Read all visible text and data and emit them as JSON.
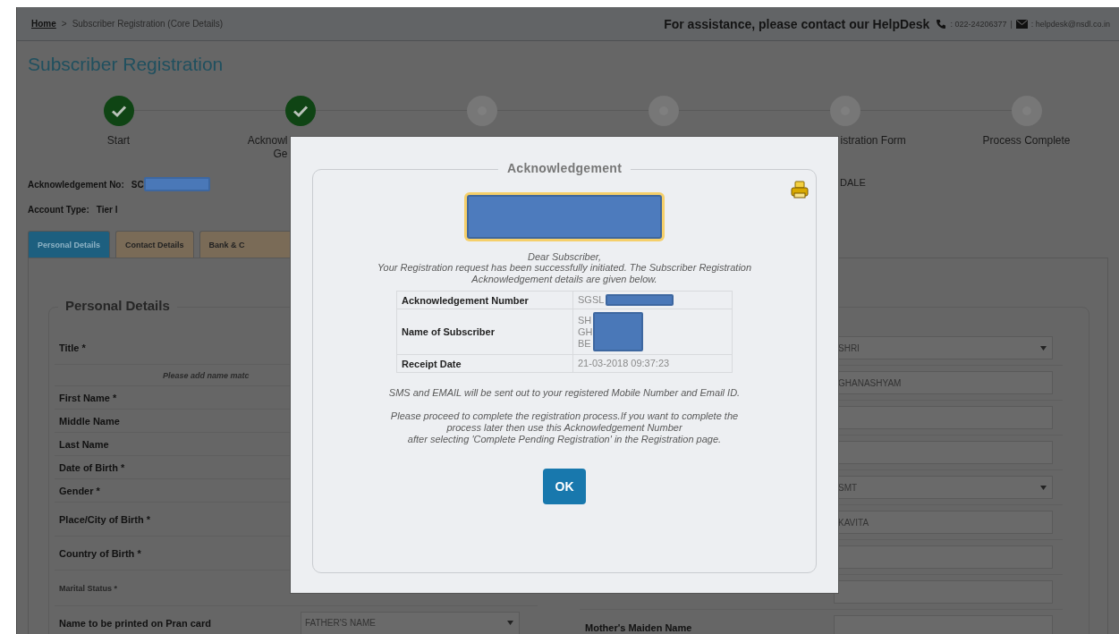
{
  "breadcrumb": [
    {
      "kind": "link",
      "label": "Home"
    },
    {
      "kind": "separator",
      "label": ">"
    },
    {
      "kind": "current",
      "label": "Subscriber Registration (Core Details)"
    }
  ],
  "helpdesk": {
    "text": "For assistance, please contact our HelpDesk",
    "phone": ": 022-24206377",
    "separator": "|",
    "email": ": helpdesk@nsdl.co.in"
  },
  "page_title": "Subscriber Registration",
  "steps": [
    {
      "label_lines": [
        "Start"
      ],
      "done": true,
      "clipped_end": false,
      "clipped_start": false
    },
    {
      "label_lines": [
        "Acknowl",
        "Ge"
      ],
      "done": true,
      "clipped_end": true,
      "clipped_start": false
    },
    {
      "done": false
    },
    {
      "done": false
    },
    {
      "label_lines": [
        "istration Form"
      ],
      "done": false,
      "clipped_end": false,
      "clipped_start": true
    },
    {
      "label_lines": [
        "Process Complete"
      ],
      "done": false,
      "clipped_end": false,
      "clipped_start": false
    }
  ],
  "acknowledgement_no": {
    "label": "Acknowledgement No:",
    "value": "SC",
    "redacted": true
  },
  "account_type": {
    "label": "Account Type:",
    "value": "Tier I"
  },
  "name_fragment": "DALE",
  "tabs": [
    {
      "label": "Personal Details",
      "selected": true
    },
    {
      "label": "Contact Details",
      "selected": false
    },
    {
      "label": "Bank & C",
      "selected": false
    }
  ],
  "personal_details": {
    "legend": "Personal Details",
    "left_rows": [
      {
        "kind": "tall",
        "label": "Title *"
      },
      {
        "kind": "note",
        "label": "Please add name matc"
      },
      {
        "kind": "short",
        "label": "First Name *"
      },
      {
        "kind": "short",
        "label": "Middle Name"
      },
      {
        "kind": "short",
        "label": "Last Name"
      },
      {
        "kind": "short",
        "label": "Date of Birth *"
      },
      {
        "kind": "short",
        "label": "Gender *"
      },
      {
        "kind": "tall",
        "label": "Place/City of Birth *"
      },
      {
        "kind": "tall",
        "label": "Country of Birth *"
      },
      {
        "kind": "small",
        "label": "Marital Status *"
      },
      {
        "kind": "tall",
        "label": "Name to be printed on Pran card",
        "select": "FATHER'S NAME"
      }
    ],
    "right_rows": [
      {
        "kind": "select",
        "value": "SHRI"
      },
      {
        "kind": "input",
        "value": "GHANASHYAM"
      },
      {
        "kind": "input"
      },
      {
        "kind": "input"
      },
      {
        "kind": "select",
        "value": "SMT"
      },
      {
        "kind": "input",
        "value": "KAVITA"
      },
      {
        "kind": "input"
      },
      {
        "kind": "input"
      },
      {
        "kind": "input",
        "label": "Mother's Maiden Name"
      }
    ]
  },
  "modal": {
    "legend": "Acknowledgement",
    "greeting": "Dear Subscriber,",
    "message": "Your Registration request has been successfully initiated. The Subscriber Registration Acknowledgement details are given below.",
    "table": [
      {
        "label": "Acknowledgement Number",
        "value_lines": [
          "SGSL"
        ],
        "redacted": true
      },
      {
        "label": "Name of Subscriber",
        "value_lines": [
          "SH",
          "GH",
          "BE"
        ],
        "redacted": true
      },
      {
        "label": "Receipt Date",
        "value_lines": [
          "21-03-2018 09:37:23"
        ],
        "redacted": false
      }
    ],
    "sms_note": "SMS and EMAIL will be sent out to your registered Mobile Number and Email ID.",
    "instructions": [
      "Please proceed to complete the registration process.If you want to complete the",
      "process later then use this Acknowledgement Number",
      "after selecting 'Complete Pending Registration' in the Registration page."
    ],
    "ok_button": "OK"
  }
}
